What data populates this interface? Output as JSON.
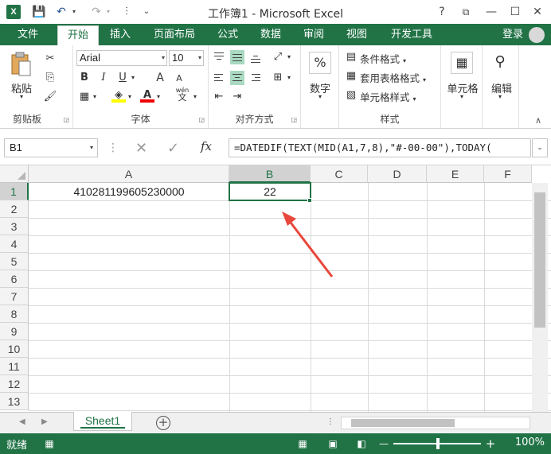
{
  "window": {
    "title": "工作簿1 - Microsoft Excel",
    "help": "?",
    "restore_ribbon": "⧉",
    "minimize": "—",
    "maximize": "☐",
    "close": "✕"
  },
  "qat": {
    "save": "💾",
    "undo": "↶",
    "redo": "↷",
    "more": "⫶",
    "customize": "⌄"
  },
  "tabs": {
    "file": "文件",
    "items": [
      "开始",
      "插入",
      "页面布局",
      "公式",
      "数据",
      "审阅",
      "视图",
      "开发工具"
    ],
    "active_index": 0,
    "login": "登录"
  },
  "ribbon": {
    "clipboard": {
      "label": "剪贴板",
      "paste": "粘贴"
    },
    "font": {
      "label": "字体",
      "name": "Arial",
      "size": "10",
      "bold": "B",
      "italic": "I",
      "underline": "U",
      "grow": "A",
      "shrink": "A",
      "font_color": "A",
      "phonetic": "wén",
      "phonetic2": "文"
    },
    "alignment": {
      "label": "对齐方式"
    },
    "number": {
      "label": "数字",
      "percent": "%"
    },
    "styles": {
      "label": "样式",
      "conditional": "条件格式",
      "table": "套用表格格式",
      "cell_styles": "单元格样式"
    },
    "cells": {
      "label": "单元格"
    },
    "editing": {
      "label": "编辑"
    }
  },
  "formula_bar": {
    "name_box": "B1",
    "cancel": "✕",
    "enter": "✓",
    "fx": "fx",
    "formula": "=DATEDIF(TEXT(MID(A1,7,8),\"#-00-00\"),TODAY(",
    "expand": "⌄"
  },
  "grid": {
    "columns": [
      "A",
      "B",
      "C",
      "D",
      "E",
      "F"
    ],
    "rows": [
      "1",
      "2",
      "3",
      "4",
      "5",
      "6",
      "7",
      "8",
      "9",
      "10",
      "11",
      "12",
      "13"
    ],
    "selected_column": "B",
    "selected_row": "1",
    "cells": {
      "A1": "410281199605230000",
      "B1": "22"
    }
  },
  "sheets": {
    "tabs": [
      "Sheet1"
    ],
    "add": "+",
    "prev": "◀",
    "next": "▶"
  },
  "status": {
    "ready": "就绪",
    "zoom": "100%",
    "zoom_minus": "—",
    "zoom_plus": "+"
  },
  "colors": {
    "accent": "#217346",
    "arrow": "#e8473b"
  }
}
